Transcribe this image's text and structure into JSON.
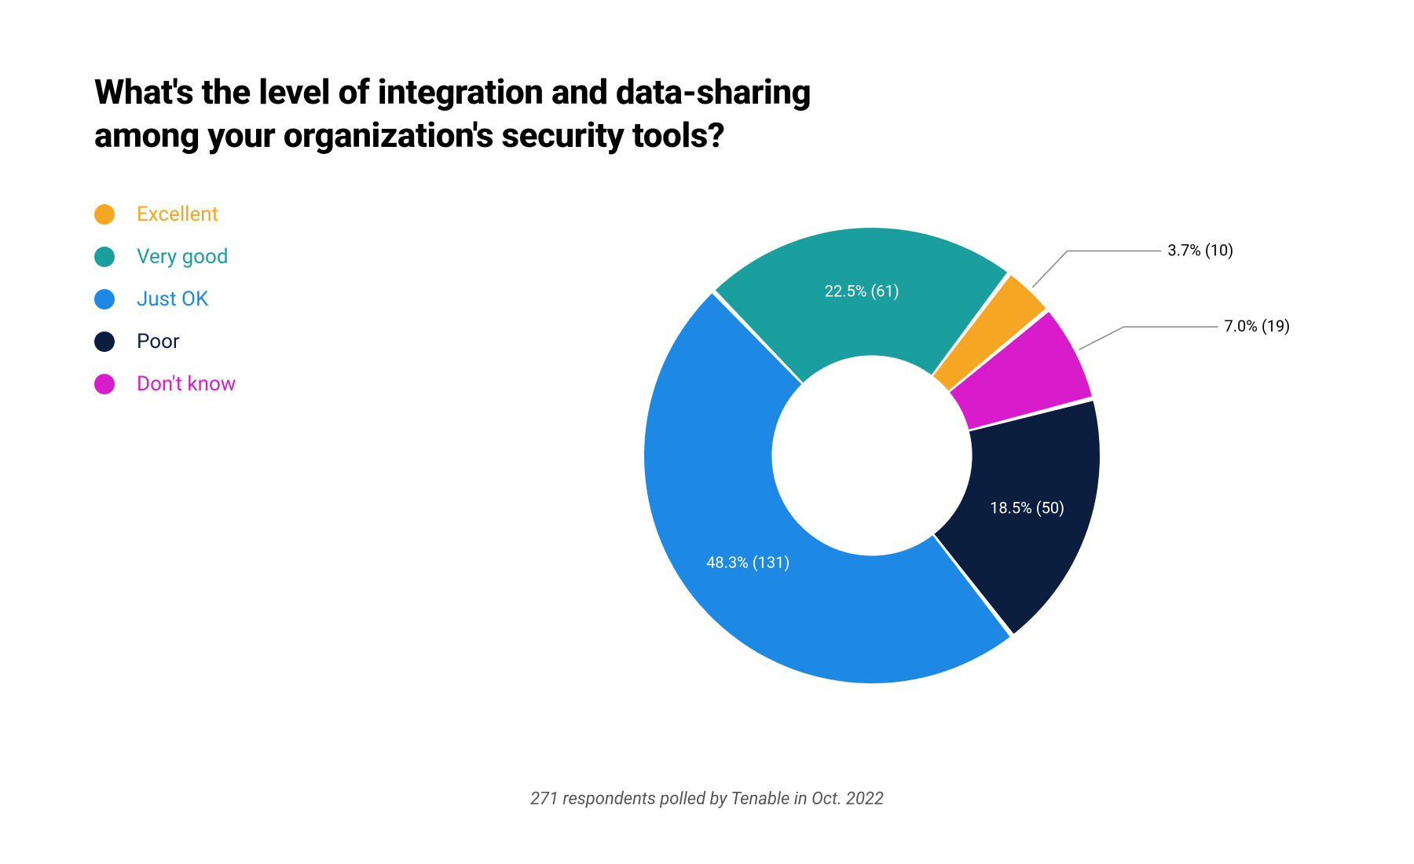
{
  "title": "What's the level of integration and data-sharing among your organization's security tools?",
  "footer": "271 respondents polled by Tenable in Oct. 2022",
  "legend": [
    {
      "label": "Excellent",
      "color": "#F5A623"
    },
    {
      "label": "Very good",
      "color": "#1B9E9E"
    },
    {
      "label": "Just OK",
      "color": "#1E88E5"
    },
    {
      "label": "Poor",
      "color": "#0B1E3F"
    },
    {
      "label": "Don't know",
      "color": "#D81BCB"
    }
  ],
  "chart_data": {
    "type": "pie",
    "title": "What's the level of integration and data-sharing among your organization's security tools?",
    "total_respondents": 271,
    "start_angle_deg": -44,
    "inner_radius_ratio": 0.44,
    "series": [
      {
        "name": "Very good",
        "percent": 22.5,
        "count": 61,
        "color": "#1B9E9E",
        "label_inside": true,
        "label": "22.5% (61)"
      },
      {
        "name": "Excellent",
        "percent": 3.7,
        "count": 10,
        "color": "#F5A623",
        "label_inside": false,
        "label": "3.7% (10)"
      },
      {
        "name": "Don't know",
        "percent": 7.0,
        "count": 19,
        "color": "#D81BCB",
        "label_inside": false,
        "label": "7.0% (19)"
      },
      {
        "name": "Poor",
        "percent": 18.5,
        "count": 50,
        "color": "#0B1E3F",
        "label_inside": true,
        "label": "18.5% (50)"
      },
      {
        "name": "Just OK",
        "percent": 48.3,
        "count": 131,
        "color": "#1E88E5",
        "label_inside": true,
        "label": "48.3% (131)"
      }
    ]
  }
}
